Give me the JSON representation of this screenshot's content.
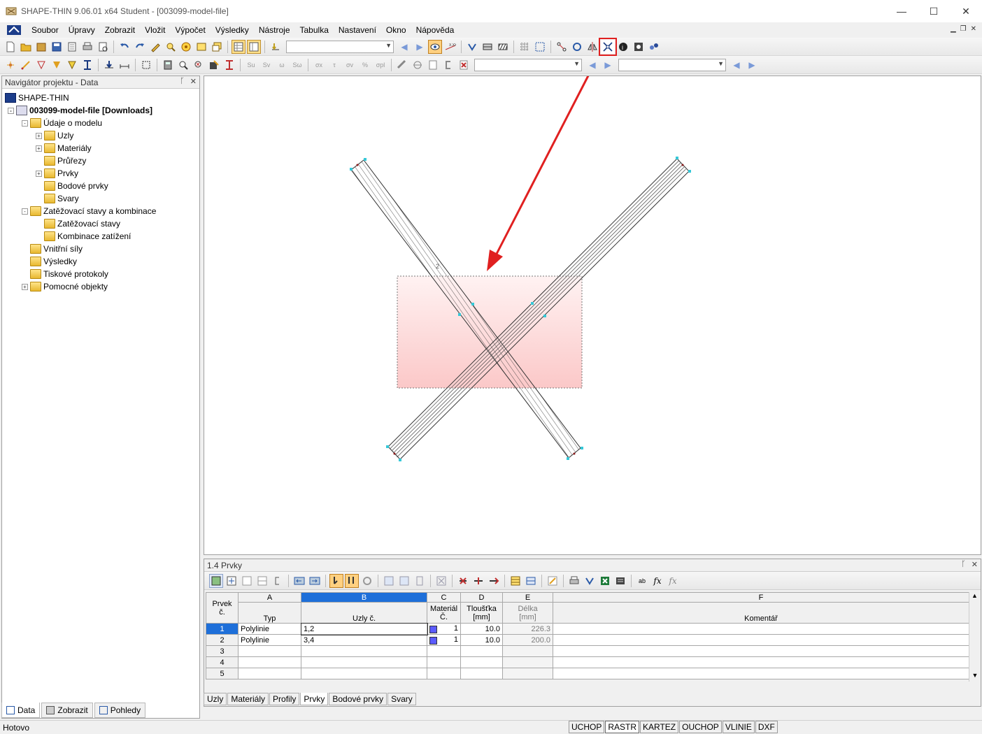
{
  "window": {
    "title": "SHAPE-THIN 9.06.01 x64 Student - [003099-model-file]",
    "minimize": "—",
    "maximize": "☐",
    "close": "✕"
  },
  "menu": [
    "Soubor",
    "Úpravy",
    "Zobrazit",
    "Vložit",
    "Výpočet",
    "Výsledky",
    "Nástroje",
    "Tabulka",
    "Nastavení",
    "Okno",
    "Nápověda"
  ],
  "navigator": {
    "title": "Navigátor projektu - Data",
    "root": "SHAPE-THIN",
    "project": "003099-model-file [Downloads]",
    "nodes": [
      {
        "label": "Údaje o modelu",
        "level": 1,
        "expander": "-"
      },
      {
        "label": "Uzly",
        "level": 2,
        "expander": "+"
      },
      {
        "label": "Materiály",
        "level": 2,
        "expander": "+"
      },
      {
        "label": "Průřezy",
        "level": 2,
        "expander": ""
      },
      {
        "label": "Prvky",
        "level": 2,
        "expander": "+"
      },
      {
        "label": "Bodové prvky",
        "level": 2,
        "expander": ""
      },
      {
        "label": "Svary",
        "level": 2,
        "expander": ""
      },
      {
        "label": "Zatěžovací stavy a kombinace",
        "level": 1,
        "expander": "-"
      },
      {
        "label": "Zatěžovací stavy",
        "level": 2,
        "expander": ""
      },
      {
        "label": "Kombinace zatížení",
        "level": 2,
        "expander": ""
      },
      {
        "label": "Vnitřní síly",
        "level": 1,
        "expander": ""
      },
      {
        "label": "Výsledky",
        "level": 1,
        "expander": ""
      },
      {
        "label": "Tiskové protokoly",
        "level": 1,
        "expander": ""
      },
      {
        "label": "Pomocné objekty",
        "level": 1,
        "expander": "+"
      }
    ],
    "tabs": [
      "Data",
      "Zobrazit",
      "Pohledy"
    ]
  },
  "canvas": {
    "member_label": "2"
  },
  "table": {
    "title": "1.4 Prvky",
    "columns": [
      "A",
      "B",
      "C",
      "D",
      "E",
      "F"
    ],
    "headers": {
      "rownum": "Prvek č.",
      "type": "Typ",
      "nodes": "Uzly č.",
      "material": "Materiál Č.",
      "thickness": "Tloušťka",
      "thickness_unit": "[mm]",
      "length": "Délka",
      "length_unit": "[mm]",
      "comment": "Komentář"
    },
    "rows": [
      {
        "no": "1",
        "type": "Polylinie",
        "nodes": "1,2",
        "material": "1",
        "thickness": "10.0",
        "length": "226.3",
        "comment": ""
      },
      {
        "no": "2",
        "type": "Polylinie",
        "nodes": "3,4",
        "material": "1",
        "thickness": "10.0",
        "length": "200.0",
        "comment": ""
      },
      {
        "no": "3",
        "type": "",
        "nodes": "",
        "material": "",
        "thickness": "",
        "length": "",
        "comment": ""
      },
      {
        "no": "4",
        "type": "",
        "nodes": "",
        "material": "",
        "thickness": "",
        "length": "",
        "comment": ""
      },
      {
        "no": "5",
        "type": "",
        "nodes": "",
        "material": "",
        "thickness": "",
        "length": "",
        "comment": ""
      }
    ],
    "tabs": [
      "Uzly",
      "Materiály",
      "Profily",
      "Prvky",
      "Bodové prvky",
      "Svary"
    ],
    "active_tab": "Prvky"
  },
  "status": {
    "text": "Hotovo",
    "toggles": [
      "UCHOP",
      "RASTR",
      "KARTEZ",
      "OUCHOP",
      "VLINIE",
      "DXF"
    ],
    "active": "RASTR"
  },
  "colors": {
    "accent": "#1e6fd9",
    "highlight": "#e02020",
    "material": "#5b5bff"
  }
}
